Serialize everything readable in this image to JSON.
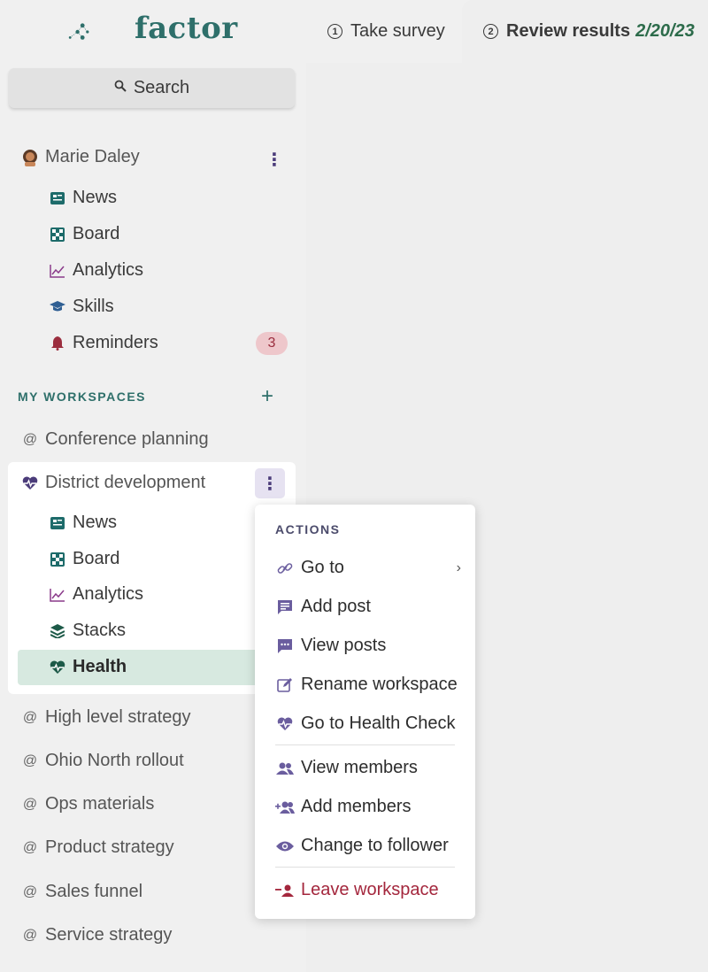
{
  "brand": {
    "name": "factor",
    "color": "#2e6f6a"
  },
  "tabs": [
    {
      "num": "1",
      "label": "Take survey"
    },
    {
      "num": "2",
      "label": "Review results",
      "date": "2/20/23"
    }
  ],
  "search": {
    "label": "Search",
    "icon": "search-icon"
  },
  "user": {
    "name": "Marie Daley",
    "items": [
      {
        "label": "News",
        "icon": "news-icon"
      },
      {
        "label": "Board",
        "icon": "board-icon"
      },
      {
        "label": "Analytics",
        "icon": "analytics-icon"
      },
      {
        "label": "Skills",
        "icon": "skills-icon"
      },
      {
        "label": "Reminders",
        "icon": "bell-icon",
        "badge": "3"
      }
    ]
  },
  "workspaces": {
    "header": "MY WORKSPACES",
    "before": [
      {
        "label": "Conference planning"
      }
    ],
    "active": {
      "label": "District development",
      "items": [
        {
          "label": "News",
          "icon": "news-icon"
        },
        {
          "label": "Board",
          "icon": "board-icon"
        },
        {
          "label": "Analytics",
          "icon": "analytics-icon"
        },
        {
          "label": "Stacks",
          "icon": "stacks-icon"
        },
        {
          "label": "Health",
          "icon": "health-icon"
        }
      ]
    },
    "after": [
      {
        "label": "High level strategy"
      },
      {
        "label": "Ohio North rollout"
      },
      {
        "label": "Ops materials"
      },
      {
        "label": "Product strategy"
      },
      {
        "label": "Sales funnel"
      },
      {
        "label": "Service strategy"
      }
    ]
  },
  "menu": {
    "title": "ACTIONS",
    "items": [
      {
        "label": "Go to",
        "icon": "link-icon"
      },
      {
        "label": "Add post",
        "icon": "post-icon"
      },
      {
        "label": "View posts",
        "icon": "chat-icon"
      },
      {
        "label": "Rename workspace",
        "icon": "edit-icon"
      },
      {
        "label": "Go to Health Check",
        "icon": "health-icon"
      },
      {
        "label": "View members",
        "icon": "members-icon"
      },
      {
        "label": "Add members",
        "icon": "add-members-icon"
      },
      {
        "label": "Change to follower",
        "icon": "eye-icon"
      },
      {
        "label": "Leave workspace",
        "icon": "leave-icon"
      }
    ]
  }
}
